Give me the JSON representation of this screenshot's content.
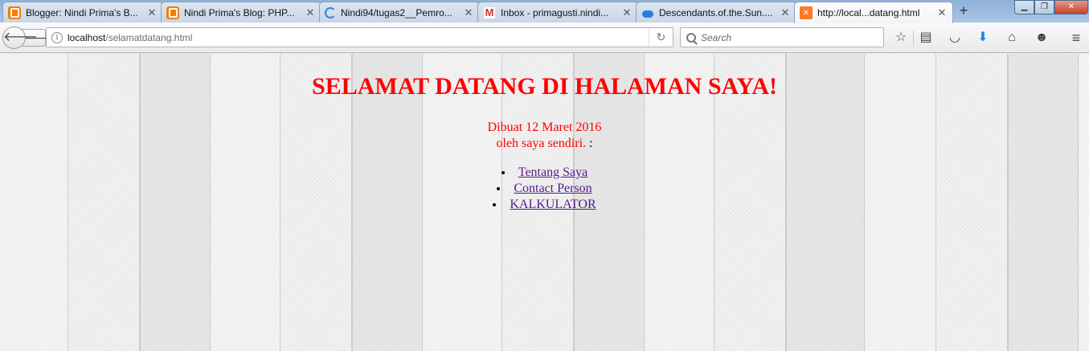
{
  "tabs": [
    {
      "title": "Blogger: Nindi Prima's B...",
      "icon": "blogger-icon",
      "active": false
    },
    {
      "title": "Nindi Prima's Blog: PHP...",
      "icon": "blogger-icon",
      "active": false
    },
    {
      "title": "Nindi94/tugas2__Pemro...",
      "icon": "loading-spinner-icon",
      "active": false
    },
    {
      "title": "Inbox - primagusti.nindi...",
      "icon": "gmail-icon",
      "active": false
    },
    {
      "title": "Descendants.of.the.Sun....",
      "icon": "cloud-icon",
      "active": false
    },
    {
      "title": "http://local...datang.html",
      "icon": "xampp-icon",
      "active": true
    }
  ],
  "tab_close_glyph": "✕",
  "new_tab_glyph": "+",
  "window_controls": {
    "minimize": "▁",
    "maximize": "❐",
    "close": "✕"
  },
  "navbar": {
    "url_host": "localhost",
    "url_path": "/selamatdatang.html",
    "search_placeholder": "Search"
  },
  "page": {
    "title": "SELAMAT DATANG DI HALAMAN SAYA!",
    "created_line": "Dibuat 12 Maret 2016",
    "author_line": "oleh saya sendiri.",
    "author_suffix": " :",
    "menu": [
      {
        "label": "Tentang Saya"
      },
      {
        "label": "Contact Person"
      },
      {
        "label": "KALKULATOR"
      }
    ],
    "text_color": "#ff0000",
    "link_color": "#551a8b"
  }
}
